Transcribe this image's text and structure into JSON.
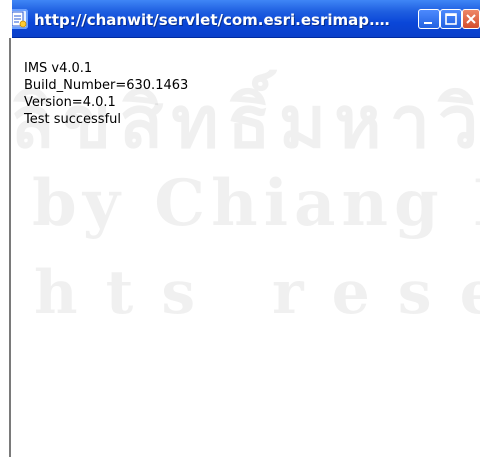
{
  "window": {
    "title": "http://chanwit/servlet/com.esri.esrimap.Esrimap?...",
    "icons": {
      "app": "ie-document-icon",
      "minimize": "minimize-icon",
      "maximize": "maximize-icon",
      "close": "close-icon"
    }
  },
  "content": {
    "lines": [
      "IMS v4.0.1",
      "Build_Number=630.1463",
      "Version=4.0.1",
      "Test successful"
    ]
  },
  "watermark": {
    "line1": "ลิขสิทธิ์มหาวิทยาลัยเชียงใหม่",
    "line2": "by Chiang Mai University",
    "line3": "hts reserved"
  }
}
